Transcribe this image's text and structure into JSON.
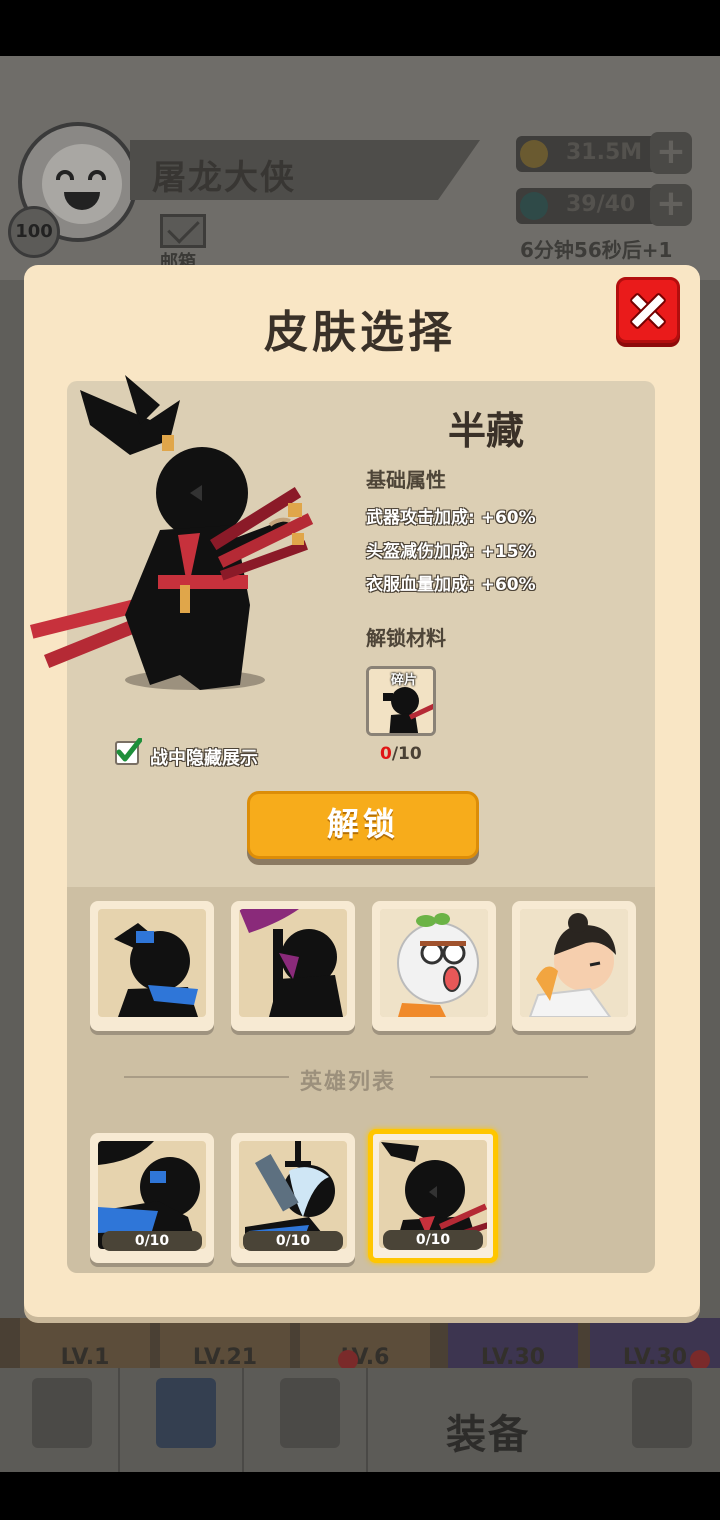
{
  "background": {
    "player_name": "屠龙大侠",
    "player_level": "100",
    "mail_label": "邮箱",
    "gold": "31.5M",
    "stamina": "39/40",
    "stamina_timer": "6分钟56秒后+1",
    "nav_label_equip": "装备",
    "card_levels": [
      "LV.1",
      "LV.21",
      "LV.6",
      "LV.30",
      "LV.30"
    ]
  },
  "modal": {
    "title": "皮肤选择",
    "skin_name": "半藏",
    "base_attr_title": "基础属性",
    "stats": [
      {
        "label": "武器攻击加成:",
        "value": "+60%"
      },
      {
        "label": "头盔减伤加成:",
        "value": "+15%"
      },
      {
        "label": "衣服血量加成:",
        "value": "+60%"
      }
    ],
    "unlock_material_title": "解锁材料",
    "material_label": "碎片",
    "material_have": "0",
    "material_need": "/10",
    "hide_in_battle_label": "战中隐藏展示",
    "hide_in_battle_checked": true,
    "unlock_button": "解锁",
    "hero_list_title": "英雄列表",
    "hero_cards": [
      {
        "progress": "0/10"
      },
      {
        "progress": "0/10"
      },
      {
        "progress": "0/10",
        "selected": true
      }
    ]
  },
  "colors": {
    "accent_button": "#f7ac1b",
    "close_button": "#ea1b1b",
    "selected_border": "#ffc600",
    "modal_bg": "#f9e6c5"
  }
}
